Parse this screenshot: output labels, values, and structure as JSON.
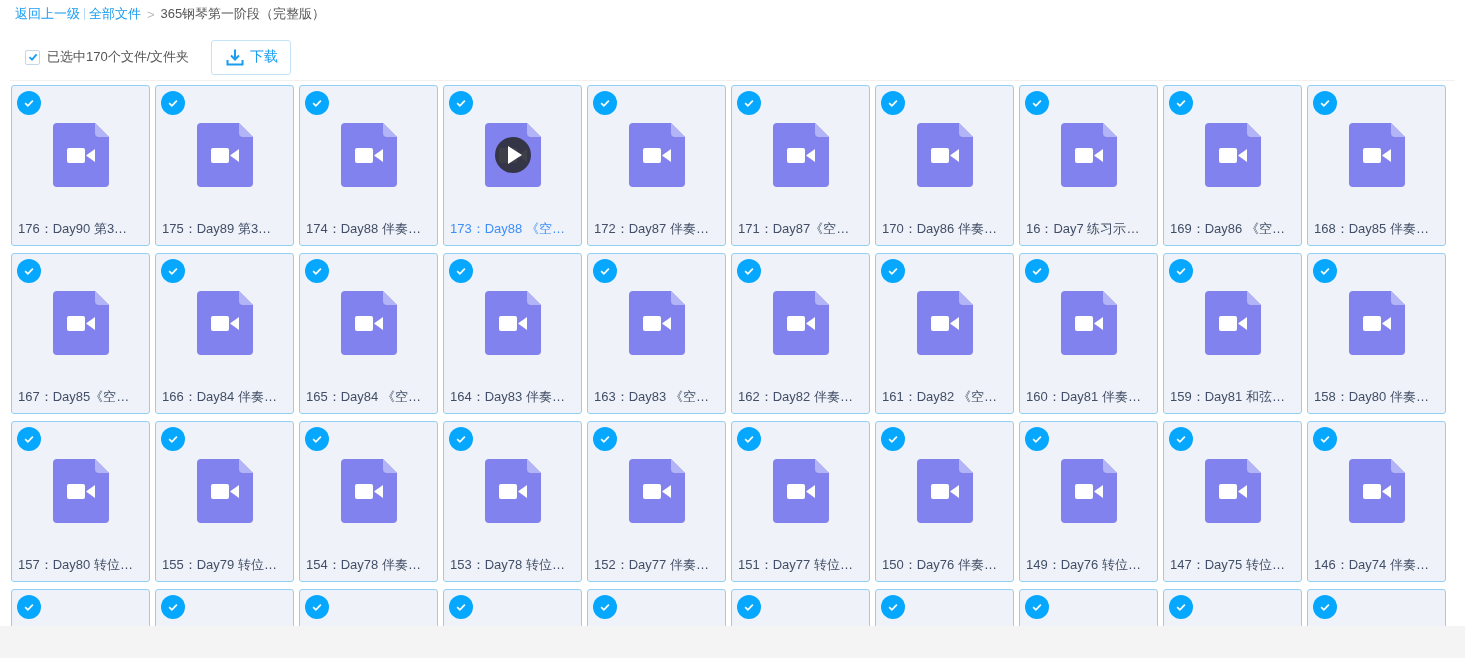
{
  "breadcrumb": {
    "back": "返回上一级",
    "root": "全部文件",
    "separator": ">",
    "current": "365钢琴第一阶段（完整版）"
  },
  "toolbar": {
    "select_all": {
      "checked": true,
      "label": "已选中170个文件/文件夹"
    },
    "download": "下载"
  },
  "files": [
    {
      "name": "176：Day90 第3…",
      "checked": true,
      "hovered": false
    },
    {
      "name": "175：Day89 第3…",
      "checked": true,
      "hovered": false
    },
    {
      "name": "174：Day88 伴奏…",
      "checked": true,
      "hovered": false
    },
    {
      "name": "173：Day88 《空…",
      "checked": true,
      "hovered": true
    },
    {
      "name": "172：Day87 伴奏…",
      "checked": true,
      "hovered": false
    },
    {
      "name": "171：Day87《空…",
      "checked": true,
      "hovered": false
    },
    {
      "name": "170：Day86 伴奏…",
      "checked": true,
      "hovered": false
    },
    {
      "name": "16：Day7 练习示…",
      "checked": true,
      "hovered": false
    },
    {
      "name": "169：Day86 《空…",
      "checked": true,
      "hovered": false
    },
    {
      "name": "168：Day85 伴奏…",
      "checked": true,
      "hovered": false
    },
    {
      "name": "167：Day85《空…",
      "checked": true,
      "hovered": false
    },
    {
      "name": "166：Day84 伴奏…",
      "checked": true,
      "hovered": false
    },
    {
      "name": "165：Day84 《空…",
      "checked": true,
      "hovered": false
    },
    {
      "name": "164：Day83 伴奏…",
      "checked": true,
      "hovered": false
    },
    {
      "name": "163：Day83 《空…",
      "checked": true,
      "hovered": false
    },
    {
      "name": "162：Day82 伴奏…",
      "checked": true,
      "hovered": false
    },
    {
      "name": "161：Day82 《空…",
      "checked": true,
      "hovered": false
    },
    {
      "name": "160：Day81 伴奏…",
      "checked": true,
      "hovered": false
    },
    {
      "name": "159：Day81 和弦…",
      "checked": true,
      "hovered": false
    },
    {
      "name": "158：Day80 伴奏…",
      "checked": true,
      "hovered": false
    },
    {
      "name": "157：Day80 转位…",
      "checked": true,
      "hovered": false
    },
    {
      "name": "155：Day79 转位…",
      "checked": true,
      "hovered": false
    },
    {
      "name": "154：Day78 伴奏…",
      "checked": true,
      "hovered": false
    },
    {
      "name": "153：Day78 转位…",
      "checked": true,
      "hovered": false
    },
    {
      "name": "152：Day77 伴奏…",
      "checked": true,
      "hovered": false
    },
    {
      "name": "151：Day77 转位…",
      "checked": true,
      "hovered": false
    },
    {
      "name": "150：Day76 伴奏…",
      "checked": true,
      "hovered": false
    },
    {
      "name": "149：Day76 转位…",
      "checked": true,
      "hovered": false
    },
    {
      "name": "147：Day75 转位…",
      "checked": true,
      "hovered": false
    },
    {
      "name": "146：Day74 伴奏…",
      "checked": true,
      "hovered": false
    },
    {
      "checked": true,
      "hovered": false
    },
    {
      "checked": true,
      "hovered": false
    },
    {
      "checked": true,
      "hovered": false
    },
    {
      "checked": true,
      "hovered": false
    },
    {
      "checked": true,
      "hovered": false
    },
    {
      "checked": true,
      "hovered": false
    },
    {
      "checked": true,
      "hovered": false
    },
    {
      "checked": true,
      "hovered": false
    },
    {
      "checked": true,
      "hovered": false
    },
    {
      "checked": true,
      "hovered": false
    }
  ]
}
